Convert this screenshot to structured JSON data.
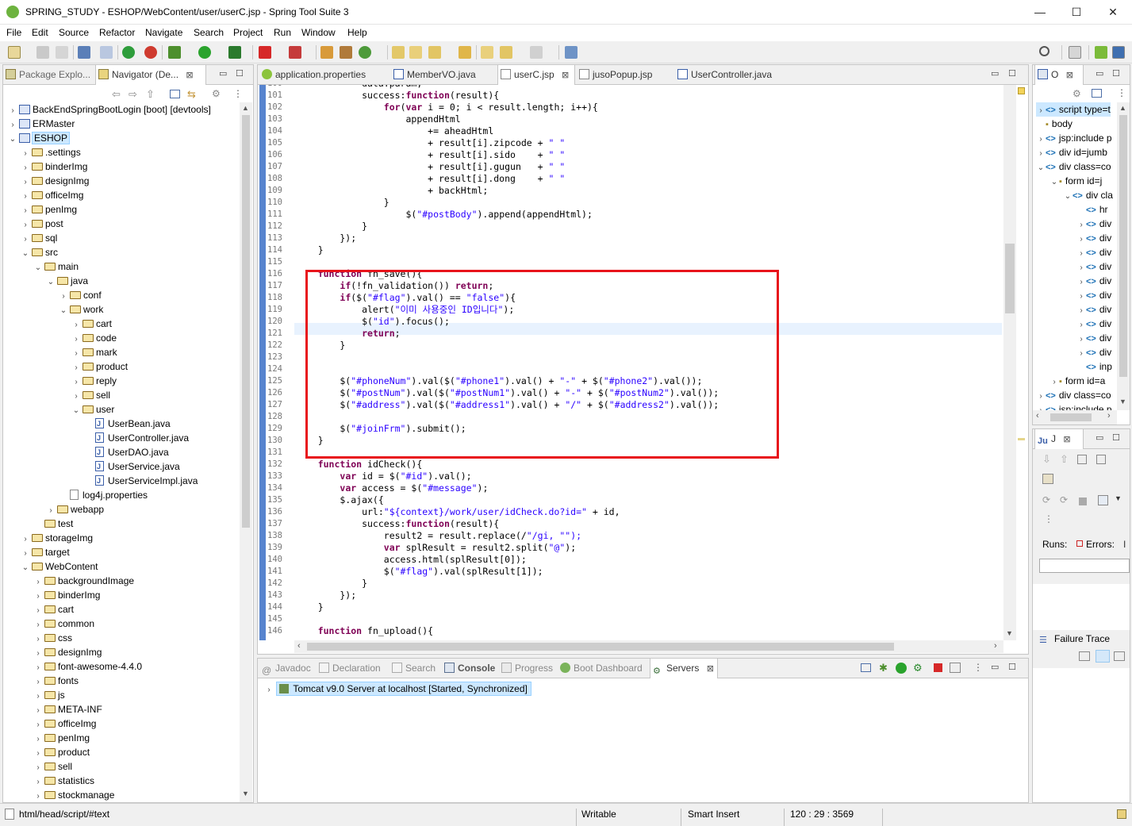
{
  "window": {
    "title": "SPRING_STUDY - ESHOP/WebContent/user/userC.jsp - Spring Tool Suite 3",
    "minimize": "—",
    "maximize": "☐",
    "close": "✕"
  },
  "menu": [
    "File",
    "Edit",
    "Source",
    "Refactor",
    "Navigate",
    "Search",
    "Project",
    "Run",
    "Window",
    "Help"
  ],
  "left_panel": {
    "tabs": [
      {
        "label": "Package Explo..."
      },
      {
        "label": "Navigator (De..."
      }
    ],
    "close_glyph": "⊠",
    "tree": [
      {
        "label": "BackEndSpringBootLogin [boot] [devtools]",
        "depth": 0,
        "kind": "project",
        "expanded": false
      },
      {
        "label": "ERMaster",
        "depth": 0,
        "kind": "project",
        "expanded": false
      },
      {
        "label": "ESHOP",
        "depth": 0,
        "kind": "project",
        "expanded": true,
        "selected": true
      },
      {
        "label": ".settings",
        "depth": 1,
        "kind": "folder",
        "expanded": false
      },
      {
        "label": "binderImg",
        "depth": 1,
        "kind": "folder",
        "expanded": false
      },
      {
        "label": "designImg",
        "depth": 1,
        "kind": "folder",
        "expanded": false
      },
      {
        "label": "officeImg",
        "depth": 1,
        "kind": "folder",
        "expanded": false
      },
      {
        "label": "penImg",
        "depth": 1,
        "kind": "folder",
        "expanded": false
      },
      {
        "label": "post",
        "depth": 1,
        "kind": "folder",
        "expanded": false
      },
      {
        "label": "sql",
        "depth": 1,
        "kind": "folder",
        "expanded": false
      },
      {
        "label": "src",
        "depth": 1,
        "kind": "folder",
        "expanded": true
      },
      {
        "label": "main",
        "depth": 2,
        "kind": "folder",
        "expanded": true
      },
      {
        "label": "java",
        "depth": 3,
        "kind": "folder",
        "expanded": true
      },
      {
        "label": "conf",
        "depth": 4,
        "kind": "folder",
        "expanded": false
      },
      {
        "label": "work",
        "depth": 4,
        "kind": "folder",
        "expanded": true
      },
      {
        "label": "cart",
        "depth": 5,
        "kind": "folder",
        "expanded": false
      },
      {
        "label": "code",
        "depth": 5,
        "kind": "folder",
        "expanded": false
      },
      {
        "label": "mark",
        "depth": 5,
        "kind": "folder",
        "expanded": false
      },
      {
        "label": "product",
        "depth": 5,
        "kind": "folder",
        "expanded": false
      },
      {
        "label": "reply",
        "depth": 5,
        "kind": "folder",
        "expanded": false
      },
      {
        "label": "sell",
        "depth": 5,
        "kind": "folder",
        "expanded": false
      },
      {
        "label": "user",
        "depth": 5,
        "kind": "folder",
        "expanded": true
      },
      {
        "label": "UserBean.java",
        "depth": 6,
        "kind": "java"
      },
      {
        "label": "UserController.java",
        "depth": 6,
        "kind": "java"
      },
      {
        "label": "UserDAO.java",
        "depth": 6,
        "kind": "java"
      },
      {
        "label": "UserService.java",
        "depth": 6,
        "kind": "java"
      },
      {
        "label": "UserServiceImpl.java",
        "depth": 6,
        "kind": "java"
      },
      {
        "label": "log4j.properties",
        "depth": 4,
        "kind": "file",
        "leaf_indent": true
      },
      {
        "label": "webapp",
        "depth": 3,
        "kind": "folder",
        "expanded": false
      },
      {
        "label": "test",
        "depth": 2,
        "kind": "folder",
        "leaf_indent": true
      },
      {
        "label": "storageImg",
        "depth": 1,
        "kind": "folder",
        "expanded": false
      },
      {
        "label": "target",
        "depth": 1,
        "kind": "folder",
        "expanded": false
      },
      {
        "label": "WebContent",
        "depth": 1,
        "kind": "folder",
        "expanded": true
      },
      {
        "label": "backgroundImage",
        "depth": 2,
        "kind": "folder",
        "expanded": false
      },
      {
        "label": "binderImg",
        "depth": 2,
        "kind": "folder",
        "expanded": false
      },
      {
        "label": "cart",
        "depth": 2,
        "kind": "folder",
        "expanded": false
      },
      {
        "label": "common",
        "depth": 2,
        "kind": "folder",
        "expanded": false
      },
      {
        "label": "css",
        "depth": 2,
        "kind": "folder",
        "expanded": false
      },
      {
        "label": "designImg",
        "depth": 2,
        "kind": "folder",
        "expanded": false
      },
      {
        "label": "font-awesome-4.4.0",
        "depth": 2,
        "kind": "folder",
        "expanded": false
      },
      {
        "label": "fonts",
        "depth": 2,
        "kind": "folder",
        "expanded": false
      },
      {
        "label": "js",
        "depth": 2,
        "kind": "folder",
        "expanded": false
      },
      {
        "label": "META-INF",
        "depth": 2,
        "kind": "folder",
        "expanded": false
      },
      {
        "label": "officeImg",
        "depth": 2,
        "kind": "folder",
        "expanded": false
      },
      {
        "label": "penImg",
        "depth": 2,
        "kind": "folder",
        "expanded": false
      },
      {
        "label": "product",
        "depth": 2,
        "kind": "folder",
        "expanded": false
      },
      {
        "label": "sell",
        "depth": 2,
        "kind": "folder",
        "expanded": false
      },
      {
        "label": "statistics",
        "depth": 2,
        "kind": "folder",
        "expanded": false
      },
      {
        "label": "stockmanage",
        "depth": 2,
        "kind": "folder",
        "expanded": false
      }
    ]
  },
  "editor": {
    "tabs": [
      {
        "label": "application.properties",
        "active": false
      },
      {
        "label": "MemberVO.java",
        "active": false
      },
      {
        "label": "userC.jsp",
        "active": true
      },
      {
        "label": "jusoPopup.jsp",
        "active": false
      },
      {
        "label": "UserController.java",
        "active": false
      }
    ],
    "close_glyph": "⊠",
    "lines": [
      {
        "n": "100",
        "t": "\t\t\tdata:param,"
      },
      {
        "n": "101",
        "t": "\t\t\tsuccess:function(result){"
      },
      {
        "n": "102",
        "t": "\t\t\t\tfor(var i = 0; i < result.length; i++){"
      },
      {
        "n": "103",
        "t": "\t\t\t\t\tappendHtml"
      },
      {
        "n": "104",
        "t": "\t\t\t\t\t\t+= aheadHtml"
      },
      {
        "n": "105",
        "t": "\t\t\t\t\t\t+ result[i].zipcode + \" \""
      },
      {
        "n": "106",
        "t": "\t\t\t\t\t\t+ result[i].sido    + \" \""
      },
      {
        "n": "107",
        "t": "\t\t\t\t\t\t+ result[i].gugun   + \" \""
      },
      {
        "n": "108",
        "t": "\t\t\t\t\t\t+ result[i].dong    + \" \""
      },
      {
        "n": "109",
        "t": "\t\t\t\t\t\t+ backHtml;"
      },
      {
        "n": "110",
        "t": "\t\t\t\t}"
      },
      {
        "n": "111",
        "t": "\t\t\t\t\t$(\"#postBody\").append(appendHtml);"
      },
      {
        "n": "112",
        "t": "\t\t\t}"
      },
      {
        "n": "113",
        "t": "\t\t});"
      },
      {
        "n": "114",
        "t": "\t}"
      },
      {
        "n": "115",
        "t": ""
      },
      {
        "n": "116",
        "t": "\tfunction fn_save(){"
      },
      {
        "n": "117",
        "t": "\t\tif(!fn_validation()) return;"
      },
      {
        "n": "118",
        "t": "\t\tif($(\"#flag\").val() == \"false\"){"
      },
      {
        "n": "119",
        "t": "\t\t\talert(\"이미 사용중인 ID입니다\");"
      },
      {
        "n": "120",
        "t": "\t\t\t$(\"id\").focus();"
      },
      {
        "n": "121",
        "t": "\t\t\treturn;"
      },
      {
        "n": "122",
        "t": "\t\t}"
      },
      {
        "n": "123",
        "t": ""
      },
      {
        "n": "124",
        "t": ""
      },
      {
        "n": "125",
        "t": "\t\t$(\"#phoneNum\").val($(\"#phone1\").val() + \"-\" + $(\"#phone2\").val());"
      },
      {
        "n": "126",
        "t": "\t\t$(\"#postNum\").val($(\"#postNum1\").val() + \"-\" + $(\"#postNum2\").val());"
      },
      {
        "n": "127",
        "t": "\t\t$(\"#address\").val($(\"#address1\").val() + \"/\" + $(\"#address2\").val());"
      },
      {
        "n": "128",
        "t": ""
      },
      {
        "n": "129",
        "t": "\t\t$(\"#joinFrm\").submit();"
      },
      {
        "n": "130",
        "t": "\t}"
      },
      {
        "n": "131",
        "t": ""
      },
      {
        "n": "132",
        "t": "\tfunction idCheck(){"
      },
      {
        "n": "133",
        "t": "\t\tvar id = $(\"#id\").val();"
      },
      {
        "n": "134",
        "t": "\t\tvar access = $(\"#message\");"
      },
      {
        "n": "135",
        "t": "\t\t$.ajax({"
      },
      {
        "n": "136",
        "t": "\t\t\turl:\"${context}/work/user/idCheck.do?id=\" + id,"
      },
      {
        "n": "137",
        "t": "\t\t\tsuccess:function(result){"
      },
      {
        "n": "138",
        "t": "\t\t\t\tresult2 = result.replace(/\"/gi, \"\");"
      },
      {
        "n": "139",
        "t": "\t\t\t\tvar splResult = result2.split(\"@\");"
      },
      {
        "n": "140",
        "t": "\t\t\t\taccess.html(splResult[0]);"
      },
      {
        "n": "141",
        "t": "\t\t\t\t$(\"#flag\").val(splResult[1]);"
      },
      {
        "n": "142",
        "t": "\t\t\t}"
      },
      {
        "n": "143",
        "t": "\t\t});"
      },
      {
        "n": "144",
        "t": "\t}"
      },
      {
        "n": "145",
        "t": ""
      },
      {
        "n": "146",
        "t": "\tfunction fn_upload(){"
      }
    ],
    "current_line": "120",
    "highlight_box": {
      "from": "116",
      "to": "130",
      "color": "#e8141b"
    }
  },
  "bottom_panel": {
    "tabs": [
      {
        "label": "Javadoc"
      },
      {
        "label": "Declaration"
      },
      {
        "label": "Search"
      },
      {
        "label": "Console"
      },
      {
        "label": "Progress"
      },
      {
        "label": "Boot Dashboard"
      },
      {
        "label": "Servers",
        "active": true
      }
    ],
    "server_row": "Tomcat v9.0 Server at localhost  [Started, Synchronized]"
  },
  "outline_panel": {
    "tab_label": "O",
    "rows": [
      {
        "tag": "<>",
        "label": "script type=t",
        "depth": 0,
        "chev": "›"
      },
      {
        "tag": "",
        "label": "body",
        "depth": 0,
        "chev": ""
      },
      {
        "tag": "<>",
        "label": "jsp:include p",
        "depth": 0,
        "chev": "›"
      },
      {
        "tag": "<>",
        "label": "div id=jumb",
        "depth": 0,
        "chev": "›"
      },
      {
        "tag": "<>",
        "label": "div class=co",
        "depth": 0,
        "chev": "⌄"
      },
      {
        "tag": "",
        "label": "form id=j",
        "depth": 1,
        "chev": "⌄"
      },
      {
        "tag": "<>",
        "label": "div cla",
        "depth": 2,
        "chev": "⌄"
      },
      {
        "tag": "<>",
        "label": "hr",
        "depth": 3,
        "chev": ""
      },
      {
        "tag": "<>",
        "label": "div",
        "depth": 3,
        "chev": "›"
      },
      {
        "tag": "<>",
        "label": "div",
        "depth": 3,
        "chev": "›"
      },
      {
        "tag": "<>",
        "label": "div",
        "depth": 3,
        "chev": "›"
      },
      {
        "tag": "<>",
        "label": "div",
        "depth": 3,
        "chev": "›"
      },
      {
        "tag": "<>",
        "label": "div",
        "depth": 3,
        "chev": "›"
      },
      {
        "tag": "<>",
        "label": "div",
        "depth": 3,
        "chev": "›"
      },
      {
        "tag": "<>",
        "label": "div",
        "depth": 3,
        "chev": "›"
      },
      {
        "tag": "<>",
        "label": "div",
        "depth": 3,
        "chev": "›"
      },
      {
        "tag": "<>",
        "label": "div",
        "depth": 3,
        "chev": "›"
      },
      {
        "tag": "<>",
        "label": "div",
        "depth": 3,
        "chev": "›"
      },
      {
        "tag": "<>",
        "label": "inp",
        "depth": 3,
        "chev": ""
      },
      {
        "tag": "",
        "label": "form id=a",
        "depth": 1,
        "chev": "›"
      },
      {
        "tag": "<>",
        "label": "div class=co",
        "depth": 0,
        "chev": "›"
      },
      {
        "tag": "<>",
        "label": "jsp:include p",
        "depth": 0,
        "chev": "›"
      }
    ]
  },
  "junit_panel": {
    "tab_label": "J",
    "runs_label": "Runs:",
    "errors_label": "Errors:",
    "failure_trace_label": "Failure Trace"
  },
  "status": {
    "path": "html/head/script/#text",
    "writable": "Writable",
    "insert_mode": "Smart Insert",
    "position": "120 : 29 : 3569"
  },
  "colors": {
    "keyword": "#7f0055",
    "string": "#2a00ff",
    "highlight_box": "#e8141b",
    "current_line_bg": "#e8f2fe",
    "selection_bg": "#cce8ff"
  }
}
